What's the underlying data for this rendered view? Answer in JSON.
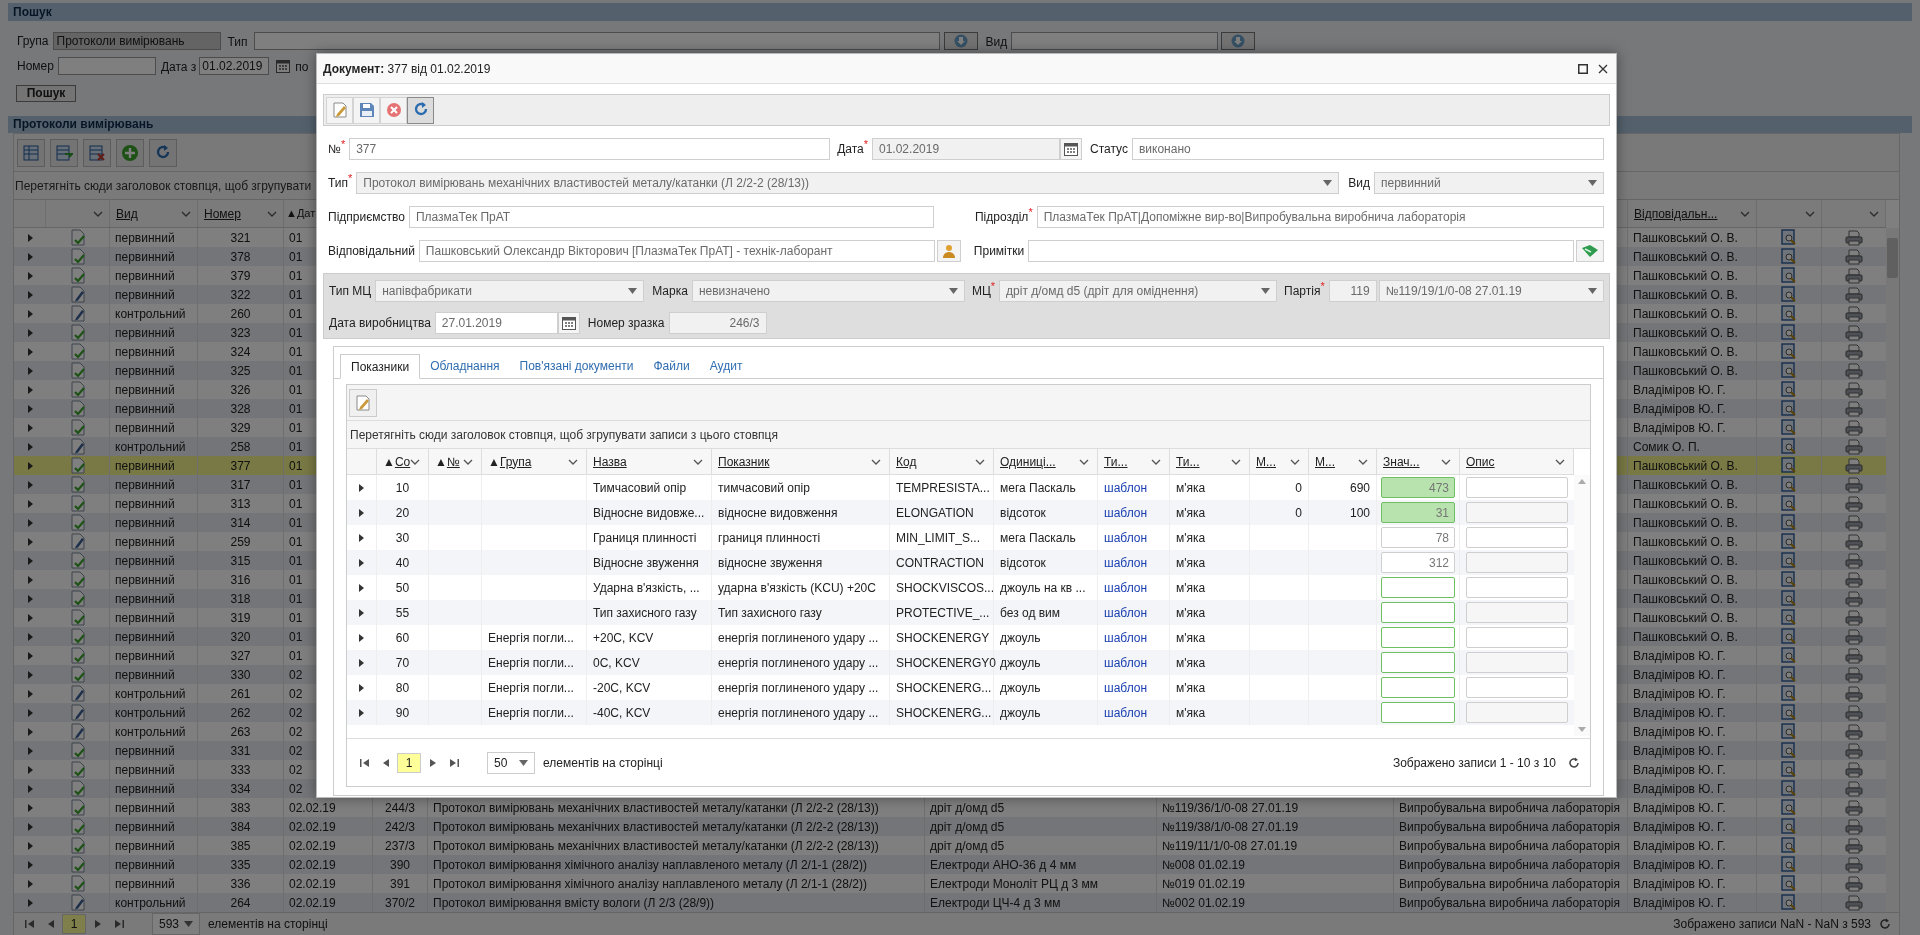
{
  "search": {
    "title": "Пошук",
    "group_label": "Група",
    "group_value": "Протоколи вимірювань",
    "type_label": "Тип",
    "vid_label": "Вид",
    "number_label": "Номер",
    "date_from_label": "Дата з",
    "date_from": "01.02.2019",
    "date_to_label": "по",
    "button": "Пошук"
  },
  "list": {
    "title": "Протоколи вимірювань",
    "group_hint": "Перетягніть сюди заголовок стовпця, щоб згрупувати",
    "columns": [
      {},
      {
        "menu": true
      },
      {
        "label": "Вид",
        "menu": true
      },
      {
        "label": "Номер",
        "menu": true
      },
      {
        "sort_mark": "▲",
        "label": "Дат"
      },
      {},
      {},
      {},
      {},
      {},
      {
        "label": "Відповідальн...",
        "menu": true
      },
      {
        "menu": true
      },
      {
        "menu": true
      }
    ],
    "rows": [
      {
        "kind": "signed",
        "vid": "первинний",
        "number": "321",
        "date": "01",
        "responsible": "Пашковський О. В.",
        "selected": false
      },
      {
        "kind": "signed",
        "vid": "первинний",
        "number": "378",
        "date": "01",
        "responsible": "Пашковський О. В.",
        "selected": false
      },
      {
        "kind": "signed",
        "vid": "первинний",
        "number": "379",
        "date": "01",
        "responsible": "Пашковський О. В.",
        "selected": false
      },
      {
        "kind": "draft",
        "vid": "первинний",
        "number": "322",
        "date": "01",
        "responsible": "Пашковський О. В.",
        "selected": false
      },
      {
        "kind": "draft",
        "vid": "контрольний",
        "number": "260",
        "date": "01",
        "responsible": "Пашковський О. В.",
        "selected": false
      },
      {
        "kind": "signed",
        "vid": "первинний",
        "number": "323",
        "date": "01",
        "responsible": "Пашковський О. В.",
        "selected": false
      },
      {
        "kind": "signed",
        "vid": "первинний",
        "number": "324",
        "date": "01",
        "responsible": "Пашковський О. В.",
        "selected": false
      },
      {
        "kind": "signed",
        "vid": "первинний",
        "number": "325",
        "date": "01",
        "responsible": "Пашковський О. В.",
        "selected": false
      },
      {
        "kind": "signed",
        "vid": "первинний",
        "number": "326",
        "date": "01",
        "responsible": "Владіміров Ю. Г.",
        "selected": false
      },
      {
        "kind": "signed",
        "vid": "первинний",
        "number": "328",
        "date": "01",
        "responsible": "Владіміров Ю. Г.",
        "selected": false
      },
      {
        "kind": "signed",
        "vid": "первинний",
        "number": "329",
        "date": "01",
        "responsible": "Владіміров Ю. Г.",
        "selected": false
      },
      {
        "kind": "draft",
        "vid": "контрольний",
        "number": "258",
        "date": "01",
        "responsible": "Сомик О. П.",
        "selected": false
      },
      {
        "kind": "signed",
        "vid": "первинний",
        "number": "377",
        "date": "01",
        "responsible": "Пашковський О. В.",
        "selected": true
      },
      {
        "kind": "signed",
        "vid": "первинний",
        "number": "317",
        "date": "01",
        "responsible": "Пашковський О. В.",
        "selected": false
      },
      {
        "kind": "signed",
        "vid": "первинний",
        "number": "313",
        "date": "01",
        "responsible": "Пашковський О. В.",
        "selected": false
      },
      {
        "kind": "signed",
        "vid": "первинний",
        "number": "314",
        "date": "01",
        "responsible": "Пашковський О. В.",
        "selected": false
      },
      {
        "kind": "draft",
        "vid": "первинний",
        "number": "259",
        "date": "01",
        "responsible": "Пашковський О. В.",
        "selected": false
      },
      {
        "kind": "signed",
        "vid": "первинний",
        "number": "315",
        "date": "01",
        "responsible": "Пашковський О. В.",
        "selected": false
      },
      {
        "kind": "signed",
        "vid": "первинний",
        "number": "316",
        "date": "01",
        "responsible": "Пашковський О. В.",
        "selected": false
      },
      {
        "kind": "signed",
        "vid": "первинний",
        "number": "318",
        "date": "01",
        "responsible": "Пашковський О. В.",
        "selected": false
      },
      {
        "kind": "signed",
        "vid": "первинний",
        "number": "319",
        "date": "01",
        "responsible": "Пашковський О. В.",
        "selected": false
      },
      {
        "kind": "signed",
        "vid": "первинний",
        "number": "320",
        "date": "01",
        "responsible": "Пашковський О. В.",
        "selected": false
      },
      {
        "kind": "signed",
        "vid": "первинний",
        "number": "327",
        "date": "01",
        "responsible": "Владіміров Ю. Г.",
        "selected": false
      },
      {
        "kind": "signed",
        "vid": "первинний",
        "number": "330",
        "date": "02",
        "responsible": "Владіміров Ю. Г.",
        "selected": false
      },
      {
        "kind": "draft",
        "vid": "контрольний",
        "number": "261",
        "date": "02",
        "responsible": "Владіміров Ю. Г.",
        "selected": false
      },
      {
        "kind": "draft",
        "vid": "контрольний",
        "number": "262",
        "date": "02",
        "responsible": "Владіміров Ю. Г.",
        "selected": false
      },
      {
        "kind": "draft",
        "vid": "контрольний",
        "number": "263",
        "date": "02",
        "responsible": "Владіміров Ю. Г.",
        "selected": false
      },
      {
        "kind": "signed",
        "vid": "первинний",
        "number": "331",
        "date": "02",
        "responsible": "Владіміров Ю. Г.",
        "selected": false
      },
      {
        "kind": "signed",
        "vid": "первинний",
        "number": "333",
        "date": "02",
        "responsible": "Владіміров Ю. Г.",
        "selected": false
      },
      {
        "kind": "signed",
        "vid": "первинний",
        "number": "334",
        "date": "02",
        "responsible": "Владіміров Ю. Г.",
        "selected": false
      },
      {
        "kind": "signed",
        "vid": "первинний",
        "number": "383",
        "date": "02.02.19",
        "sample": "244/3",
        "protocol": "Протокол вимірювань механічних властивостей металу/катанки (Л 2/2-2 (28/13))",
        "material": "дріт д/омд d5",
        "batch": "№119/36/1/0-08 27.01.19",
        "department": "Випробувальна виробнича лабораторія",
        "responsible": "Владіміров Ю. Г.",
        "selected": false
      },
      {
        "kind": "signed",
        "vid": "первинний",
        "number": "384",
        "date": "02.02.19",
        "sample": "242/3",
        "protocol": "Протокол вимірювань механічних властивостей металу/катанки (Л 2/2-2 (28/13))",
        "material": "дріт д/омд d5",
        "batch": "№119/38/1/0-08 27.01.19",
        "department": "Випробувальна виробнича лабораторія",
        "responsible": "Владіміров Ю. Г.",
        "selected": false
      },
      {
        "kind": "signed",
        "vid": "первинний",
        "number": "385",
        "date": "02.02.19",
        "sample": "237/3",
        "protocol": "Протокол вимірювань механічних властивостей металу/катанки (Л 2/2-2 (28/13))",
        "material": "дріт д/омд d5",
        "batch": "№119/11/1/0-08 27.01.19",
        "department": "Випробувальна виробнича лабораторія",
        "responsible": "Владіміров Ю. Г.",
        "selected": false
      },
      {
        "kind": "signed",
        "vid": "первинний",
        "number": "335",
        "date": "02.02.19",
        "sample": "390",
        "protocol": "Протокол вимірювання хімічного аналізу наплавленого металу (Л 2/1-1 (28/2))",
        "material": "Електроди АНО-36 д 4 мм",
        "batch": "№008 01.02.19",
        "department": "Випробувальна виробнича лабораторія",
        "responsible": "Владіміров Ю. Г.",
        "selected": false
      },
      {
        "kind": "signed",
        "vid": "первинний",
        "number": "336",
        "date": "02.02.19",
        "sample": "391",
        "protocol": "Протокол вимірювання хімічного аналізу наплавленого металу (Л 2/1-1 (28/2))",
        "material": "Електроди Моноліт РЦ д 3 мм",
        "batch": "№019 01.02.19",
        "department": "Випробувальна виробнича лабораторія",
        "responsible": "Владіміров Ю. Г.",
        "selected": false
      },
      {
        "kind": "draft",
        "vid": "контрольний",
        "number": "264",
        "date": "02.02.19",
        "sample": "370/2",
        "protocol": "Протокол вимірювання вмісту вологи (Л 2/3 (28/9))",
        "material": "Електроди ЦЧ-4 д 3 мм",
        "batch": "№002 01.02.19",
        "department": "Випробувальна виробнича лабораторія",
        "responsible": "Владіміров Ю. Г.",
        "selected": false
      }
    ],
    "pager": {
      "page": "1",
      "page_size": "593",
      "page_size_label": "елементів на сторінці",
      "summary": "Зображено записи NaN - NaN з 593"
    }
  },
  "dialog": {
    "title": "**Документ:** 377 від 01.02.2019",
    "toolbar": [
      {
        "kind": "edit",
        "active": false
      },
      {
        "kind": "save",
        "active": false
      },
      {
        "kind": "cancel",
        "active": false
      },
      {
        "kind": "refresh",
        "active": true
      }
    ],
    "form_rows": [
      [
        {
          "label": "№$^{*}$",
          "value": "377",
          "kind": "text",
          "readonly": false
        },
        {
          "label": "Дата$^{*}$",
          "value": "01.02.2019",
          "kind": "date",
          "readonly": true
        },
        {
          "label": "Статус",
          "value": "виконано",
          "kind": "text",
          "readonly": false
        }
      ],
      [
        {
          "label": "Тип$^{*}$",
          "value": "Протокол вимірювань механічних властивостей металу/катанки (Л 2/2-2 (28/13))",
          "kind": "dropdown",
          "readonly": true
        },
        {
          "label": "Вид",
          "value": "первинний",
          "kind": "dropdown",
          "readonly": true
        }
      ],
      [
        {
          "label": "Підприємство",
          "value": "ПлазмаТек ПрАТ",
          "kind": "text",
          "readonly": false
        },
        {
          "label": "Підрозділ$^{*}$",
          "value": "ПлазмаТек ПрАТ|Допоміжне вир-во|Випробувальна виробнича лабораторія",
          "kind": "text",
          "readonly": false
        }
      ],
      [
        {
          "label": "Відповідальний",
          "value": "Пашковський Олександр Вікторович [ПлазмаТек ПрАТ] - технік-лаборант",
          "kind": "person",
          "readonly": false
        },
        {
          "label": "Примітки",
          "kind": "note",
          "readonly": false
        }
      ]
    ],
    "details_rows": [
      [
        {
          "label": "Тип МЦ",
          "value": "напівфабрикати",
          "kind": "dropdown",
          "readonly": true
        },
        {
          "label": "Марка",
          "value": "невизначено",
          "kind": "dropdown",
          "readonly": true
        },
        {
          "label": "МЦ$^{*}$",
          "value": "дріт д/омд d5 (дріт для оміднення)",
          "kind": "dropdown",
          "readonly": true
        },
        {
          "label": "Партія$^{*}$",
          "value": "119",
          "kind": "number",
          "readonly": true
        },
        {
          "value": "№119/19/1/0-08 27.01.19",
          "kind": "dropdown",
          "readonly": true
        }
      ],
      [
        {
          "label": "Дата виробництва",
          "value": "27.01.2019",
          "kind": "date",
          "readonly": false
        },
        {
          "label": "Номер зразка",
          "value": "246/3",
          "kind": "number",
          "readonly": true
        }
      ]
    ],
    "tabs": [
      {
        "label": "Показники",
        "selected": true
      },
      {
        "label": "Обладнання",
        "selected": false
      },
      {
        "label": "Пов'язані документи",
        "selected": false
      },
      {
        "label": "Файли",
        "selected": false
      },
      {
        "label": "Аудит",
        "selected": false
      }
    ],
    "indicators": {
      "group_hint": "Перетягніть сюди заголовок стовпця, щоб згрупувати записи з цього стовпця",
      "columns": [
        {},
        {
          "sort_mark": "▲",
          "label": "Со"
        },
        {
          "sort_mark": "▲",
          "label": "№"
        },
        {
          "sort_mark": "▲",
          "label": "Група"
        },
        {
          "label": "Назва"
        },
        {
          "label": "Показник"
        },
        {
          "label": "Код"
        },
        {
          "label": "Одиниці..."
        },
        {
          "label": "Ти..."
        },
        {
          "label": "Ти..."
        },
        {
          "label": "М..."
        },
        {
          "label": "М..."
        },
        {
          "label": "Знач..."
        },
        {
          "label": "Опис"
        }
      ],
      "rows": [
        {
          "order": "10",
          "name": "Тимчасовий опір",
          "indicator": "тимчасовий опір",
          "code": "TEMPRESISTA...",
          "unit": "мега Паскаль",
          "template": "шаблон",
          "hardness": "м'яка",
          "min": "0",
          "max": "690",
          "value": "473",
          "kind": "pass"
        },
        {
          "order": "20",
          "name": "Відносне видовже...",
          "indicator": "відносне видовження",
          "code": "ELONGATION",
          "unit": "відсоток",
          "template": "шаблон",
          "hardness": "м'яка",
          "min": "0",
          "max": "100",
          "value": "31",
          "kind": "pass"
        },
        {
          "order": "30",
          "name": "Границя плинності",
          "indicator": "границя плинності",
          "code": "MIN_LIMIT_S...",
          "unit": "мега Паскаль",
          "template": "шаблон",
          "hardness": "м'яка",
          "value": "78",
          "kind": "plain"
        },
        {
          "order": "40",
          "name": "Відносне звуження",
          "indicator": "відносне звуження",
          "code": "CONTRACTION",
          "unit": "відсоток",
          "template": "шаблон",
          "hardness": "м'яка",
          "value": "312",
          "kind": "plain"
        },
        {
          "order": "50",
          "name": "Ударна в'язкість, ...",
          "indicator": "ударна в'язкість (KCU) +20C",
          "code": "SHOCKVISCOS...",
          "unit": "джоуль на кв ...",
          "template": "шаблон",
          "hardness": "м'яка",
          "kind": "pending"
        },
        {
          "order": "55",
          "name": "Тип захисного газу",
          "indicator": "Тип захисного газу",
          "code": "PROTECTIVE_...",
          "unit": "без од вим",
          "template": "шаблон",
          "hardness": "м'яка",
          "kind": "pending"
        },
        {
          "order": "60",
          "group": "Енергія погли...",
          "name": "+20C, KCV",
          "indicator": "енергія поглиненого удару ...",
          "code": "SHOCKENERGY",
          "unit": "джоуль",
          "template": "шаблон",
          "hardness": "м'яка",
          "kind": "pending"
        },
        {
          "order": "70",
          "group": "Енергія погли...",
          "name": "0C, KCV",
          "indicator": "енергія поглиненого удару ...",
          "code": "SHOCKENERGY0",
          "unit": "джоуль",
          "template": "шаблон",
          "hardness": "м'яка",
          "kind": "pending"
        },
        {
          "order": "80",
          "group": "Енергія погли...",
          "name": "-20C, KCV",
          "indicator": "енергія поглиненого удару ...",
          "code": "SHOCKENERG...",
          "unit": "джоуль",
          "template": "шаблон",
          "hardness": "м'яка",
          "kind": "pending"
        },
        {
          "order": "90",
          "group": "Енергія погли...",
          "name": "-40C, KCV",
          "indicator": "енергія поглиненого удару ...",
          "code": "SHOCKENERG...",
          "unit": "джоуль",
          "template": "шаблон",
          "hardness": "м'яка",
          "kind": "pending"
        }
      ],
      "pager": {
        "page": "1",
        "page_size": "50",
        "page_size_label": "елементів на сторінці",
        "summary": "Зображено записи 1 - 10 з 10"
      }
    }
  }
}
